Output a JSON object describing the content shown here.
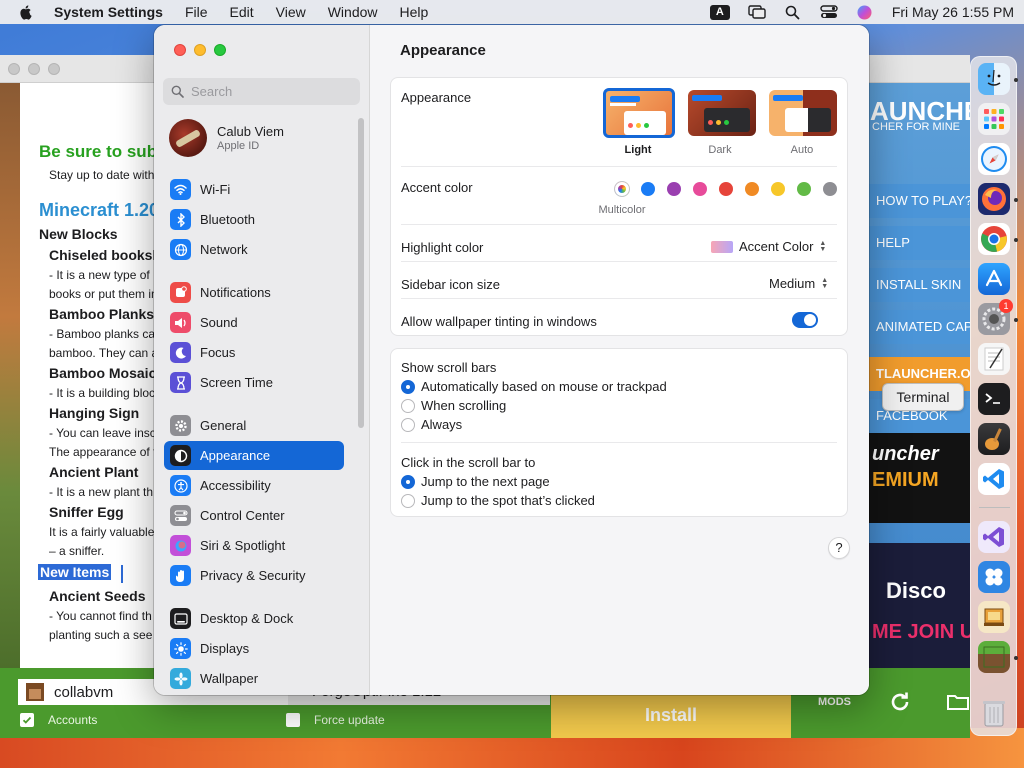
{
  "menubar": {
    "app_name": "System Settings",
    "menus": [
      "File",
      "Edit",
      "View",
      "Window",
      "Help"
    ],
    "input_badge": "A",
    "datetime": "Fri May 26  1:55 PM"
  },
  "launcher": {
    "article": {
      "headline": "Be sure to subscribe",
      "subline": "Stay up to date with",
      "title": "Minecraft 1.20",
      "section_new_blocks": "New Blocks",
      "items": [
        {
          "heading": "Chiseled bookshelf",
          "lines": [
            "- It is a new type of",
            "books or put them in"
          ]
        },
        {
          "heading": "Bamboo Planks",
          "lines": [
            "- Bamboo planks can",
            "bamboo. They can a"
          ]
        },
        {
          "heading": "Bamboo Mosaic",
          "lines": [
            "- It is a building block"
          ]
        },
        {
          "heading": "Hanging Sign",
          "lines": [
            "- You can leave inscr",
            "The appearance of th"
          ]
        },
        {
          "heading": "Ancient Plant",
          "lines": [
            "- It is a new plant th"
          ]
        },
        {
          "heading": "Sniffer Egg",
          "lines": [
            "It is a fairly valuable",
            "– a sniffer."
          ]
        }
      ],
      "selected_heading": "New Items",
      "after_items": [
        {
          "heading": "Ancient Seeds",
          "lines": [
            "- You cannot find th",
            "planting such a see"
          ]
        }
      ]
    },
    "right": {
      "title": "AUNCHER",
      "subtitle": "CHER FOR MINE",
      "buttons": [
        "HOW TO PLAY?",
        "HELP",
        "INSTALL SKIN",
        "ANIMATED CAPE"
      ],
      "site_button": "TLAUNCHER.ORG",
      "fb_button": "FACEBOOK",
      "premium_line1": "uncher",
      "premium_line2": "EMIUM",
      "discord_line1": "Disco",
      "discord_line2": "ME JOIN U"
    },
    "bottom": {
      "username": "collabvm",
      "version": "ForgeOptiFine 1.12",
      "accounts_label": "Accounts",
      "force_update_label": "Force update",
      "install_label": "Install",
      "mods_label": "MODS"
    }
  },
  "dock": {
    "tooltip": "Terminal",
    "badge": "1"
  },
  "settings": {
    "search_placeholder": "Search",
    "profile": {
      "name": "Calub Viem",
      "subtitle": "Apple ID"
    },
    "sidebar": [
      {
        "label": "Wi-Fi",
        "icon": "wifi-icon",
        "color": "#1a7cf5"
      },
      {
        "label": "Bluetooth",
        "icon": "bluetooth-icon",
        "color": "#1a7cf5"
      },
      {
        "label": "Network",
        "icon": "globe-icon",
        "color": "#1a7cf5"
      },
      {
        "label": "Notifications",
        "icon": "bell-icon",
        "color": "#ee4c48"
      },
      {
        "label": "Sound",
        "icon": "speaker-icon",
        "color": "#ee4c6a"
      },
      {
        "label": "Focus",
        "icon": "moon-icon",
        "color": "#5b50d6"
      },
      {
        "label": "Screen Time",
        "icon": "hourglass-icon",
        "color": "#5b50d6"
      },
      {
        "label": "General",
        "icon": "gear-icon",
        "color": "#8e8e93"
      },
      {
        "label": "Appearance",
        "icon": "appearance-icon",
        "color": "#1d1d1f"
      },
      {
        "label": "Accessibility",
        "icon": "accessibility-icon",
        "color": "#1a7cf5"
      },
      {
        "label": "Control Center",
        "icon": "control-center-icon",
        "color": "#8e8e93"
      },
      {
        "label": "Siri & Spotlight",
        "icon": "siri-icon",
        "color": "#c24fd8"
      },
      {
        "label": "Privacy & Security",
        "icon": "hand-icon",
        "color": "#1a7cf5"
      },
      {
        "label": "Desktop & Dock",
        "icon": "dock-icon",
        "color": "#1d1d1f"
      },
      {
        "label": "Displays",
        "icon": "sun-icon",
        "color": "#1a7cf5"
      },
      {
        "label": "Wallpaper",
        "icon": "wallpaper-icon",
        "color": "#34aadc"
      }
    ],
    "active_item": "Appearance",
    "title": "Appearance",
    "appearance": {
      "label": "Appearance",
      "options": [
        "Light",
        "Dark",
        "Auto"
      ],
      "selected": "Light"
    },
    "accent": {
      "label": "Accent color",
      "selected_caption": "Multicolor",
      "colors": [
        "multicolor",
        "#1a7cf5",
        "#9a3fb0",
        "#e74b9a",
        "#e6443a",
        "#f08a24",
        "#f7c729",
        "#62ba46",
        "#8e8e93"
      ]
    },
    "highlight": {
      "label": "Highlight color",
      "value": "Accent Color"
    },
    "sidebar_icon_size": {
      "label": "Sidebar icon size",
      "value": "Medium"
    },
    "wallpaper_tinting": {
      "label": "Allow wallpaper tinting in windows",
      "enabled": true
    },
    "scroll_bars": {
      "label": "Show scroll bars",
      "options": [
        "Automatically based on mouse or trackpad",
        "When scrolling",
        "Always"
      ],
      "selected": 0
    },
    "click_scroll": {
      "label": "Click in the scroll bar to",
      "options": [
        "Jump to the next page",
        "Jump to the spot that’s clicked"
      ],
      "selected": 0
    },
    "help": "?"
  }
}
